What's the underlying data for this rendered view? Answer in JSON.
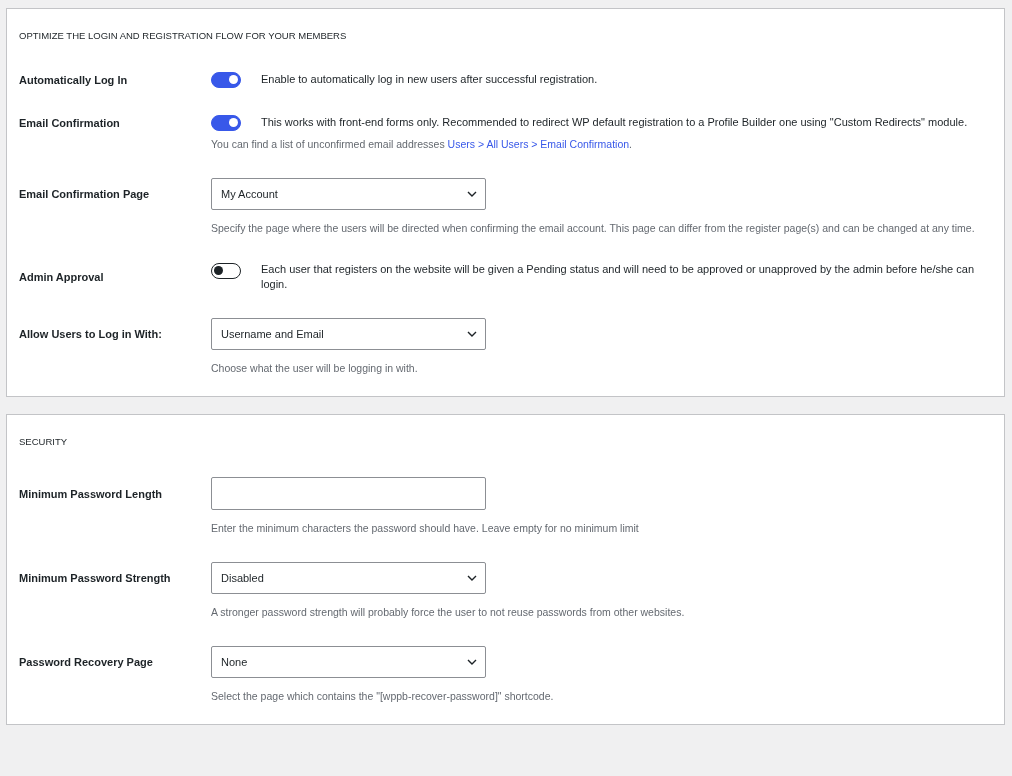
{
  "sections": [
    {
      "title": "OPTIMIZE THE LOGIN AND REGISTRATION FLOW FOR YOUR MEMBERS",
      "fields": [
        {
          "kind": "toggle",
          "label": "Automatically Log In",
          "on": true,
          "description": "Enable to automatically log in new users after successful registration."
        },
        {
          "kind": "toggle",
          "label": "Email Confirmation",
          "on": true,
          "description": "This works with front-end forms only. Recommended to redirect WP default registration to a Profile Builder one using \"Custom Redirects\" module.",
          "note": {
            "text": "You can find a list of unconfirmed email addresses",
            "link": "Users > All Users > Email Confirmation",
            "end": "."
          }
        },
        {
          "kind": "select",
          "label": "Email Confirmation Page",
          "value": "My Account",
          "description": "Specify the page where the users will be directed when confirming the email account. This page can differ from the register page(s) and can be changed at any time."
        },
        {
          "kind": "toggle",
          "label": "Admin Approval",
          "on": false,
          "description": "Each user that registers on the website will be given a Pending status and will need to be approved or unapproved by the admin before he/she can login."
        },
        {
          "kind": "select",
          "label": "Allow Users to Log in With:",
          "value": "Username and Email",
          "description": "Choose what the user will be logging in with."
        }
      ]
    },
    {
      "title": "SECURITY",
      "fields": [
        {
          "kind": "text",
          "label": "Minimum Password Length",
          "description": "Enter the minimum characters the password should have. Leave empty for no minimum limit"
        },
        {
          "kind": "select",
          "label": "Minimum Password Strength",
          "value": "Disabled",
          "description": "A stronger password strength will probably force the user to not reuse passwords from other websites."
        },
        {
          "kind": "select",
          "label": "Password Recovery Page",
          "value": "None",
          "description": "Select the page which contains the \"[wppb-recover-password]\" shortcode."
        }
      ]
    }
  ]
}
